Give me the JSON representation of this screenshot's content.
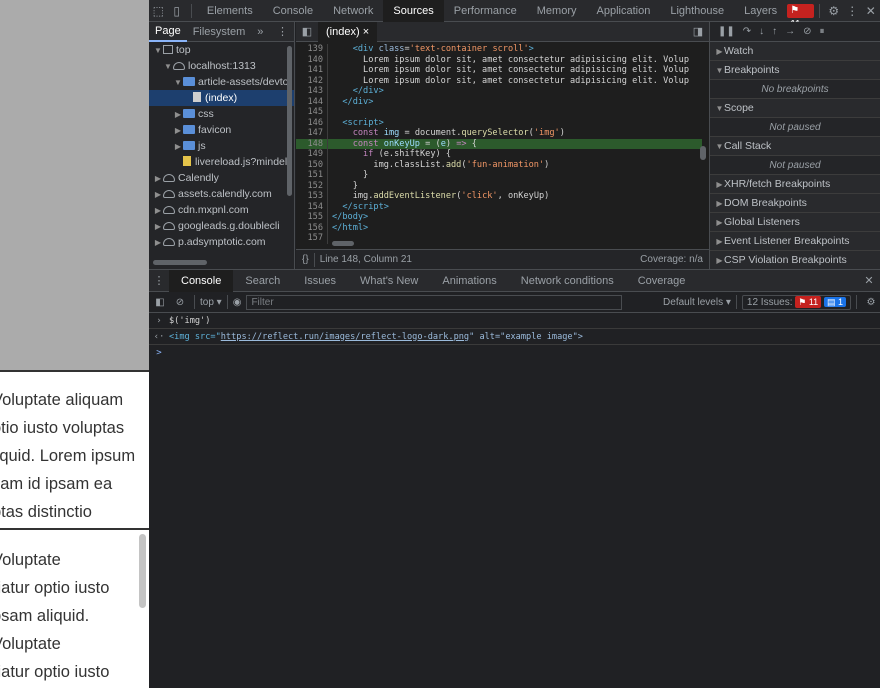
{
  "page": {
    "box1_lines": [
      "Voluptate aliquam",
      "otio iusto voluptas",
      "liquid. Lorem ipsum",
      "sam id ipsam ea",
      "ptas distinctio"
    ],
    "box2_lines": [
      "Voluptate",
      "riatur optio iusto",
      "psam aliquid.",
      "Voluptate",
      "riatur optio iusto"
    ]
  },
  "devtools": {
    "main_tabs": [
      "Elements",
      "Console",
      "Network",
      "Sources",
      "Performance",
      "Memory",
      "Application",
      "Lighthouse",
      "Layers"
    ],
    "active_main_tab": "Sources",
    "error_count": "11",
    "navigator": {
      "tabs": [
        "Page",
        "Filesystem"
      ],
      "more": "»",
      "tree": [
        {
          "label": "top",
          "icon": "frame-icon",
          "depth": 0,
          "arrow": "▼"
        },
        {
          "label": "localhost:1313",
          "icon": "cloud-icon",
          "depth": 1,
          "arrow": "▼"
        },
        {
          "label": "article-assets/devto",
          "icon": "folder-icon",
          "depth": 2,
          "arrow": "▼"
        },
        {
          "label": "(index)",
          "icon": "file-icon",
          "depth": 3,
          "arrow": "",
          "selected": true
        },
        {
          "label": "css",
          "icon": "folder-icon",
          "depth": 2,
          "arrow": "▶"
        },
        {
          "label": "favicon",
          "icon": "folder-icon",
          "depth": 2,
          "arrow": "▶"
        },
        {
          "label": "js",
          "icon": "folder-icon",
          "depth": 2,
          "arrow": "▶"
        },
        {
          "label": "livereload.js?mindel",
          "icon": "script-file-icon",
          "depth": 2,
          "arrow": ""
        },
        {
          "label": "Calendly",
          "icon": "cloud-icon",
          "depth": 0,
          "arrow": "▶"
        },
        {
          "label": "assets.calendly.com",
          "icon": "cloud-icon",
          "depth": 0,
          "arrow": "▶"
        },
        {
          "label": "cdn.mxpnl.com",
          "icon": "cloud-icon",
          "depth": 0,
          "arrow": "▶"
        },
        {
          "label": "googleads.g.doublecli",
          "icon": "cloud-icon",
          "depth": 0,
          "arrow": "▶"
        },
        {
          "label": "p.adsymptotic.com",
          "icon": "cloud-icon",
          "depth": 0,
          "arrow": "▶"
        }
      ]
    },
    "editor": {
      "tab_label": "(index)",
      "close": "×",
      "status": "Line 148, Column 21",
      "coverage": "Coverage: n/a",
      "brackets": "{}",
      "lines": [
        {
          "n": "139",
          "html": "    <span class='tg'>&lt;div</span> <span class='at'>class</span>=<span class='sv'>'text-container scroll'</span><span class='tg'>&gt;</span>"
        },
        {
          "n": "140",
          "html": "      Lorem ipsum dolor sit, amet consectetur adipisicing elit. Volup"
        },
        {
          "n": "141",
          "html": "      Lorem ipsum dolor sit, amet consectetur adipisicing elit. Volup"
        },
        {
          "n": "142",
          "html": "      Lorem ipsum dolor sit, amet consectetur adipisicing elit. Volup"
        },
        {
          "n": "143",
          "html": "    <span class='tg'>&lt;/div&gt;</span>"
        },
        {
          "n": "144",
          "html": "  <span class='tg'>&lt;/div&gt;</span>"
        },
        {
          "n": "145",
          "html": ""
        },
        {
          "n": "146",
          "html": "  <span class='tg'>&lt;script&gt;</span>"
        },
        {
          "n": "147",
          "html": "    <span class='kw'>const</span> <span class='vr'>img</span> = document.<span class='fn'>querySelector</span>(<span class='sv'>'img'</span>)"
        },
        {
          "n": "148",
          "html": "    <span class='kw'>const</span> <span class='vr'>onKeyUp</span> = (<span class='vr'>e</span>) <span class='kw'>=&gt;</span> {",
          "hl": true
        },
        {
          "n": "149",
          "html": "      <span class='kw'>if</span> (e.shiftKey) {"
        },
        {
          "n": "150",
          "html": "        img.classList.<span class='fn'>add</span>(<span class='sv'>'fun-animation'</span>)"
        },
        {
          "n": "151",
          "html": "      }"
        },
        {
          "n": "152",
          "html": "    }"
        },
        {
          "n": "153",
          "html": "    img.<span class='fn'>addEventListener</span>(<span class='sv'>'click'</span>, onKeyUp)"
        },
        {
          "n": "154",
          "html": "  <span class='tg'>&lt;/script&gt;</span>"
        },
        {
          "n": "155",
          "html": "<span class='tg'>&lt;/body&gt;</span>"
        },
        {
          "n": "156",
          "html": "<span class='tg'>&lt;/html&gt;</span>"
        },
        {
          "n": "157",
          "html": ""
        }
      ]
    },
    "debugger": {
      "sections": [
        {
          "label": "Watch",
          "open": false,
          "body": ""
        },
        {
          "label": "Breakpoints",
          "open": true,
          "body": "No breakpoints"
        },
        {
          "label": "Scope",
          "open": true,
          "body": "Not paused"
        },
        {
          "label": "Call Stack",
          "open": true,
          "body": "Not paused"
        },
        {
          "label": "XHR/fetch Breakpoints",
          "open": false,
          "body": ""
        },
        {
          "label": "DOM Breakpoints",
          "open": false,
          "body": ""
        },
        {
          "label": "Global Listeners",
          "open": false,
          "body": ""
        },
        {
          "label": "Event Listener Breakpoints",
          "open": false,
          "body": ""
        },
        {
          "label": "CSP Violation Breakpoints",
          "open": false,
          "body": ""
        }
      ]
    },
    "drawer": {
      "tabs": [
        "Console",
        "Search",
        "Issues",
        "What's New",
        "Animations",
        "Network conditions",
        "Coverage"
      ],
      "active_tab": "Console",
      "context": "top",
      "filter_placeholder": "Filter",
      "levels": "Default levels",
      "issues": "12 Issues:",
      "issue_errors": "11",
      "issue_info": "1",
      "input_cmd": "$('img')",
      "output_pre": "<img src=\"",
      "output_url": "https://reflect.run/images/reflect-logo-dark.png",
      "output_post": "\" alt=\"example image\">",
      "prompt": ">"
    }
  }
}
